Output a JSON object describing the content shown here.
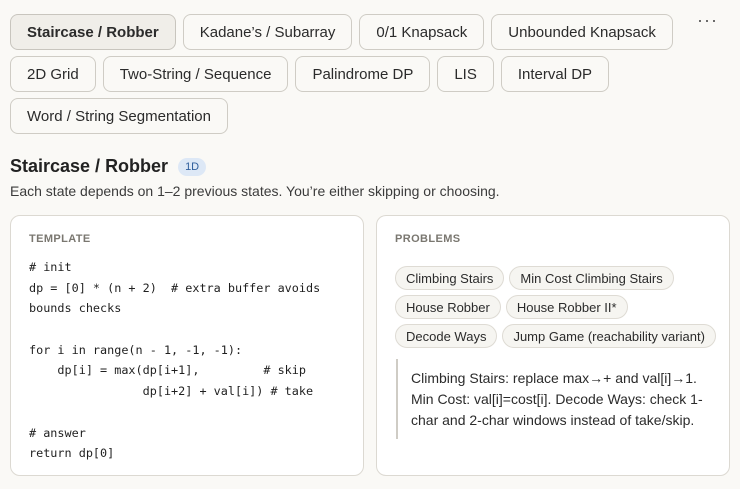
{
  "tabs": [
    {
      "label": "Staircase / Robber",
      "active": true
    },
    {
      "label": "Kadane’s / Subarray",
      "active": false
    },
    {
      "label": "0/1 Knapsack",
      "active": false
    },
    {
      "label": "Unbounded Knapsack",
      "active": false
    },
    {
      "label": "2D Grid",
      "active": false
    },
    {
      "label": "Two-String / Sequence",
      "active": false
    },
    {
      "label": "Palindrome DP",
      "active": false
    },
    {
      "label": "LIS",
      "active": false
    },
    {
      "label": "Interval DP",
      "active": false
    },
    {
      "label": "Word / String Segmentation",
      "active": false
    }
  ],
  "more_label": "···",
  "section": {
    "title": "Staircase / Robber",
    "badge": "1D",
    "description": "Each state depends on 1–2 previous states. You’re either skipping or choosing."
  },
  "template_card": {
    "label": "TEMPLATE",
    "code_lines": [
      "# init",
      "dp = [0] * (n + 2)  # extra buffer avoids",
      "bounds checks",
      "",
      "for i in range(n - 1, -1, -1):",
      "    dp[i] = max(dp[i+1],         # skip",
      "                dp[i+2] + val[i]) # take",
      "",
      "# answer",
      "return dp[0]"
    ]
  },
  "problems_card": {
    "label": "PROBLEMS",
    "problems": [
      "Climbing Stairs",
      "Min Cost Climbing Stairs",
      "House Robber",
      "House Robber II*",
      "Decode Ways",
      "Jump Game (reachability variant)"
    ],
    "note": "Climbing Stairs: replace max→+ and val[i]→1. Min Cost: val[i]=cost[i]. Decode Ways: check 1-char and 2-char windows instead of take/skip."
  }
}
